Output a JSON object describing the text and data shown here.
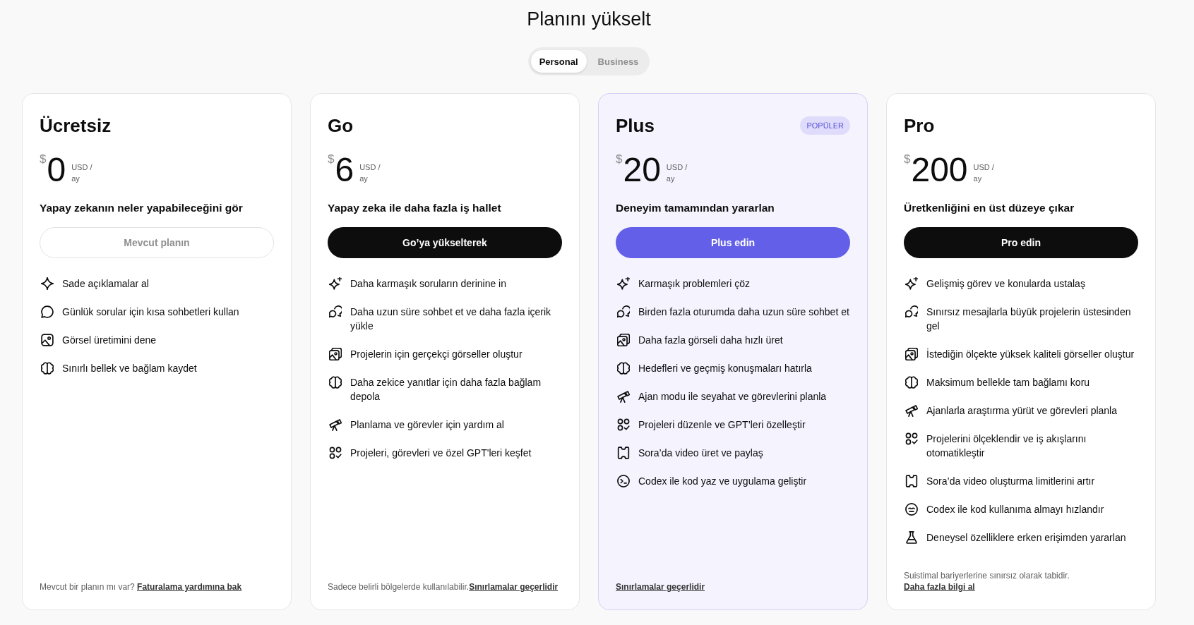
{
  "title": "Planını yükselt",
  "plan_types": [
    {
      "label": "Personal",
      "selected": true
    },
    {
      "label": "Business",
      "selected": false
    }
  ],
  "plans": [
    {
      "name": "Ücretsiz",
      "highlighted": false,
      "currency": "$",
      "price": "0",
      "unit": "USD /",
      "period": "ay",
      "tagline": "Yapay zekanın neler yapabileceğini gör",
      "button": {
        "label": "Mevcut planın",
        "kind": "current"
      },
      "features": [
        {
          "kind": "sparkle",
          "text": "Sade açıklamalar al"
        },
        {
          "kind": "bubble",
          "text": "Günlük sorular için kısa sohbetleri kullan"
        },
        {
          "kind": "picture",
          "text": "Görsel üretimini dene"
        },
        {
          "kind": "brain",
          "text": "Sınırlı bellek ve bağlam kaydet"
        }
      ],
      "footer": {
        "text": "Mevcut bir planın mı var? ",
        "link": "Faturalama yardımına bak"
      }
    },
    {
      "name": "Go",
      "highlighted": false,
      "currency": "$",
      "price": "6",
      "unit": "USD /",
      "period": "ay",
      "tagline": "Yapay zeka ile daha fazla iş hallet",
      "button": {
        "label": "Go’ya yükselterek",
        "kind": "dark"
      },
      "features": [
        {
          "kind": "sparkles",
          "text": "Daha karmaşık soruların derinine in"
        },
        {
          "kind": "bubbles",
          "text": "Daha uzun süre sohbet et ve daha fazla içerik yükle"
        },
        {
          "kind": "pictures",
          "text": "Projelerin için gerçekçi görseller oluştur"
        },
        {
          "kind": "brain",
          "text": "Daha zekice yanıtlar için daha fazla bağlam depola"
        },
        {
          "kind": "telescope",
          "text": "Planlama ve görevler için yardım al"
        },
        {
          "kind": "shapes",
          "text": "Projeleri, görevleri ve özel GPT'leri keşfet"
        }
      ],
      "footer": {
        "text": "Sadece belirli bölgelerde kullanılabilir.",
        "link": "Sınırlamalar geçerlidir"
      }
    },
    {
      "name": "Plus",
      "highlighted": true,
      "badge": "POPÜLER",
      "currency": "$",
      "price": "20",
      "unit": "USD /",
      "period": "ay",
      "tagline": "Deneyim tamamından yararlan",
      "button": {
        "label": "Plus edin",
        "kind": "accent"
      },
      "features": [
        {
          "kind": "sparkles",
          "text": "Karmaşık problemleri çöz"
        },
        {
          "kind": "bubbles",
          "text": "Birden fazla oturumda daha uzun süre sohbet et"
        },
        {
          "kind": "pictures",
          "text": "Daha fazla görseli daha hızlı üret"
        },
        {
          "kind": "brain",
          "text": "Hedefleri ve geçmiş konuşmaları hatırla"
        },
        {
          "kind": "telescope",
          "text": "Ajan modu ile seyahat ve görevlerini planla"
        },
        {
          "kind": "shapes",
          "text": "Projeleri düzenle ve GPT’leri özelleştir"
        },
        {
          "kind": "ticket",
          "text": "Sora’da video üret ve paylaş"
        },
        {
          "kind": "terminal",
          "text": "Codex ile kod yaz ve uygulama geliştir"
        }
      ],
      "footer": {
        "link": "Sınırlamalar geçerlidir"
      }
    },
    {
      "name": "Pro",
      "highlighted": false,
      "currency": "$",
      "price": "200",
      "unit": "USD /",
      "period": "ay",
      "tagline": "Üretkenliğini en üst düzeye çıkar",
      "button": {
        "label": "Pro edin",
        "kind": "dark"
      },
      "features": [
        {
          "kind": "sparkles",
          "text": "Gelişmiş görev ve konularda ustalaş"
        },
        {
          "kind": "bubbles",
          "text": "Sınırsız mesajlarla büyük projelerin üstesinden gel"
        },
        {
          "kind": "pictures",
          "text": "İstediğin ölçekte yüksek kaliteli görseller oluştur"
        },
        {
          "kind": "brain",
          "text": "Maksimum bellekle tam bağlamı koru"
        },
        {
          "kind": "telescope",
          "text": "Ajanlarla araştırma yürüt ve görevleri planla"
        },
        {
          "kind": "shapes",
          "text": "Projelerini ölçeklendir ve iş akışlarını otomatikleştir"
        },
        {
          "kind": "ticket",
          "text": "Sora’da video oluşturma limitlerini artır"
        },
        {
          "kind": "face",
          "text": "Codex ile kod kullanıma almayı hızlandır"
        },
        {
          "kind": "flask",
          "text": "Deneysel özelliklere erken erişimden yararlan"
        }
      ],
      "footer": {
        "text": "Suistimal bariyerlerine sınırsız olarak tabidir. ",
        "link": "Daha fazla bilgi al"
      }
    }
  ]
}
